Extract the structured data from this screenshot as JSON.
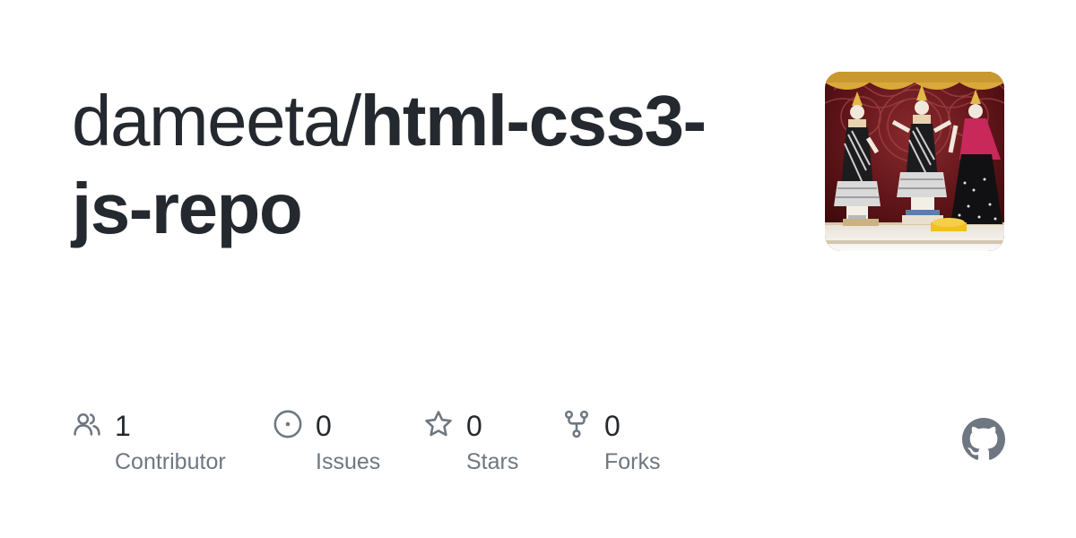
{
  "repo": {
    "owner": "dameeta/",
    "name": "html-css3-js-repo"
  },
  "avatar": {
    "alt": "repository owner avatar"
  },
  "stats": {
    "contributors": {
      "count": "1",
      "label": "Contributor",
      "icon": "people-icon"
    },
    "issues": {
      "count": "0",
      "label": "Issues",
      "icon": "issue-opened-icon"
    },
    "stars": {
      "count": "0",
      "label": "Stars",
      "icon": "star-icon"
    },
    "forks": {
      "count": "0",
      "label": "Forks",
      "icon": "repo-forked-icon"
    }
  },
  "brand": {
    "icon": "github-mark-icon",
    "color": "#6e7781"
  },
  "colors": {
    "text": "#24292f",
    "muted": "#6e7781"
  }
}
